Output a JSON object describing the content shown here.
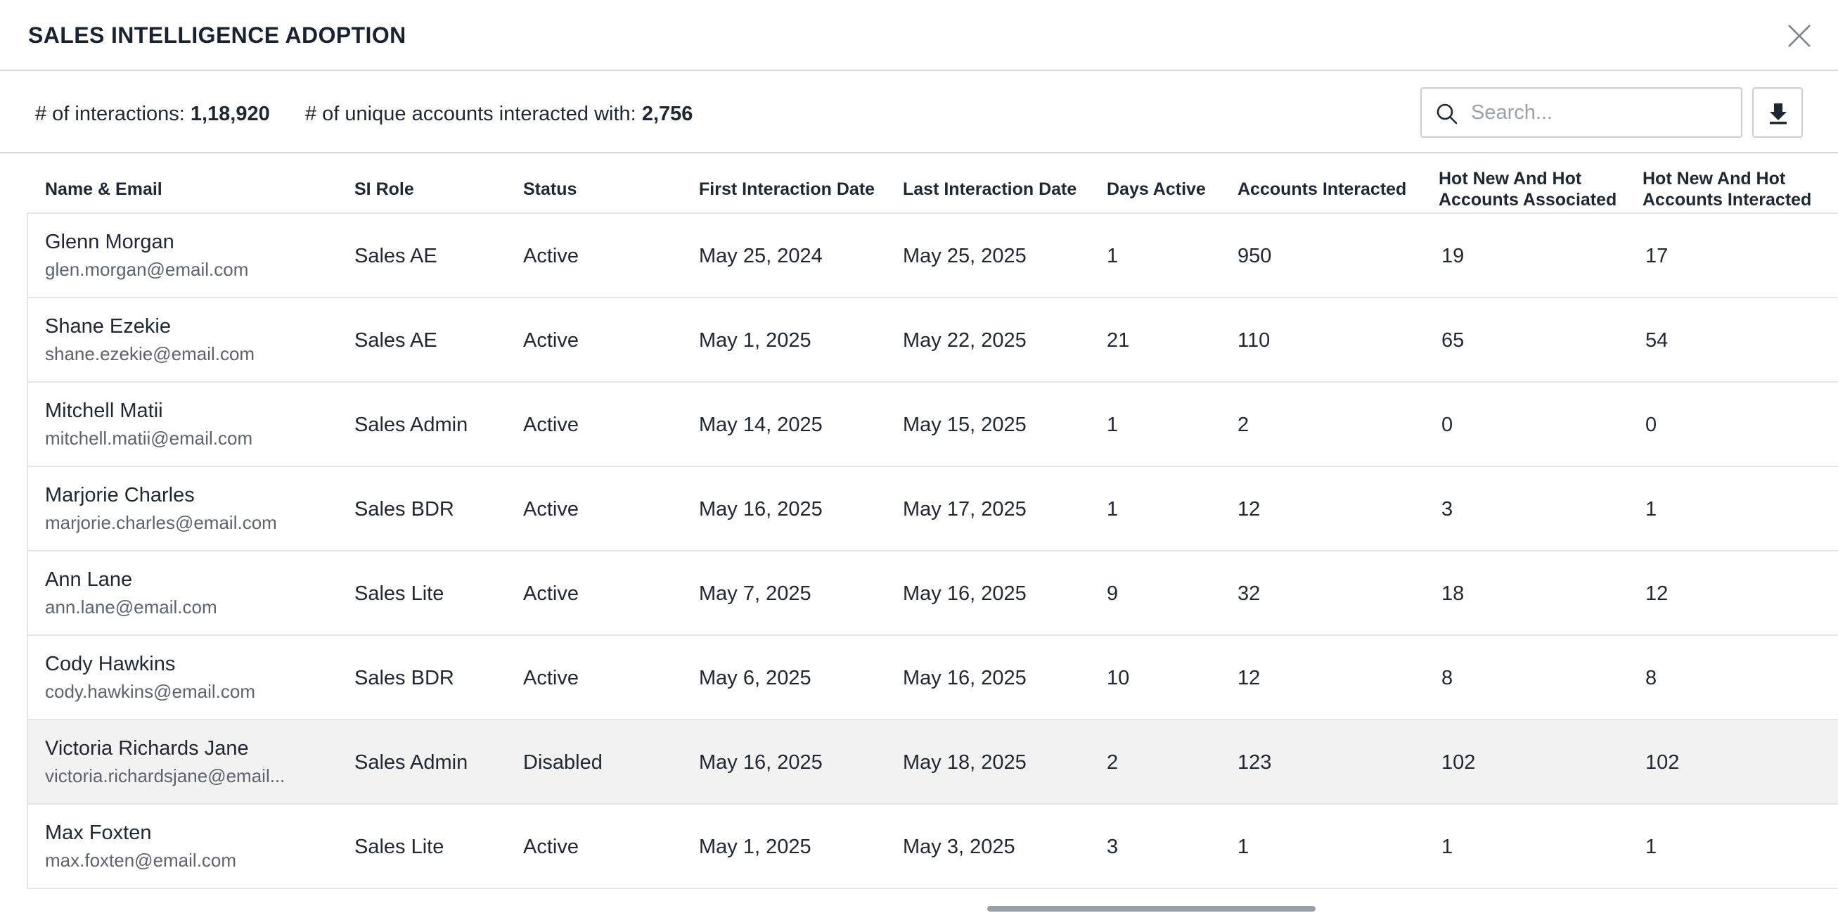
{
  "modal": {
    "title": "SALES INTELLIGENCE ADOPTION",
    "close_icon": "close-icon"
  },
  "summary": {
    "interactions_label": "# of interactions:",
    "interactions_value": "1,18,920",
    "accounts_label": "# of unique accounts interacted with:",
    "accounts_value": "2,756"
  },
  "search": {
    "placeholder": "Search...",
    "value": "",
    "icon": "search-icon"
  },
  "download": {
    "icon": "download-icon"
  },
  "table": {
    "headers": [
      "Name & Email",
      "SI Role",
      "Status",
      "First Interaction Date",
      "Last Interaction Date",
      "Days Active",
      "Accounts Interacted",
      "Hot New And Hot\nAccounts Associated",
      "Hot New And Hot\nAccounts Interacted"
    ],
    "rows": [
      {
        "name": "Glenn Morgan",
        "email": "glen.morgan@email.com",
        "role": "Sales AE",
        "status": "Active",
        "first": "May 25, 2024",
        "last": "May 25, 2025",
        "days": "1",
        "accounts": "950",
        "hot_assoc": "19",
        "hot_inter": "17"
      },
      {
        "name": "Shane Ezekie",
        "email": "shane.ezekie@email.com",
        "role": "Sales AE",
        "status": "Active",
        "first": "May 1, 2025",
        "last": "May 22, 2025",
        "days": "21",
        "accounts": "110",
        "hot_assoc": "65",
        "hot_inter": "54"
      },
      {
        "name": "Mitchell Matii",
        "email": "mitchell.matii@email.com",
        "role": "Sales Admin",
        "status": "Active",
        "first": "May 14, 2025",
        "last": "May 15, 2025",
        "days": "1",
        "accounts": "2",
        "hot_assoc": "0",
        "hot_inter": "0"
      },
      {
        "name": "Marjorie Charles",
        "email": "marjorie.charles@email.com",
        "role": "Sales BDR",
        "status": "Active",
        "first": "May 16, 2025",
        "last": "May 17, 2025",
        "days": "1",
        "accounts": "12",
        "hot_assoc": "3",
        "hot_inter": "1"
      },
      {
        "name": "Ann Lane",
        "email": "ann.lane@email.com",
        "role": "Sales Lite",
        "status": "Active",
        "first": "May 7, 2025",
        "last": "May 16, 2025",
        "days": "9",
        "accounts": "32",
        "hot_assoc": "18",
        "hot_inter": "12"
      },
      {
        "name": "Cody Hawkins",
        "email": "cody.hawkins@email.com",
        "role": "Sales BDR",
        "status": "Active",
        "first": "May 6, 2025",
        "last": "May 16, 2025",
        "days": "10",
        "accounts": "12",
        "hot_assoc": "8",
        "hot_inter": "8"
      },
      {
        "name": "Victoria Richards Jane",
        "email": "victoria.richardsjane@email...",
        "role": "Sales Admin",
        "status": "Disabled",
        "first": "May 16, 2025",
        "last": "May 18, 2025",
        "days": "2",
        "accounts": "123",
        "hot_assoc": "102",
        "hot_inter": "102"
      },
      {
        "name": "Max Foxten",
        "email": "max.foxten@email.com",
        "role": "Sales Lite",
        "status": "Active",
        "first": "May 1, 2025",
        "last": "May 3, 2025",
        "days": "3",
        "accounts": "1",
        "hot_assoc": "1",
        "hot_inter": "1"
      }
    ]
  },
  "colors": {
    "border": "#d4d7dc",
    "row_hover": "#f3f2f2",
    "text": "#1f2733",
    "muted": "#5c636d"
  }
}
